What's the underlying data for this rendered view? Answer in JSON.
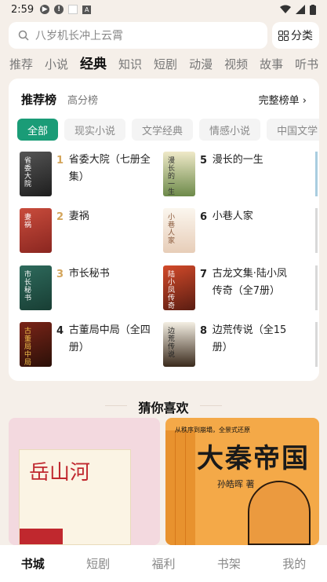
{
  "status_bar": {
    "time": "2:59",
    "icon_a": "A"
  },
  "search": {
    "placeholder": "八岁机长冲上云霄",
    "category_label": "分类"
  },
  "top_tabs": [
    "推荐",
    "小说",
    "经典",
    "知识",
    "短剧",
    "动漫",
    "视频",
    "故事",
    "听书"
  ],
  "active_tab": "经典",
  "rank": {
    "tab_active": "推荐榜",
    "tab_inactive": "高分榜",
    "full_link": "完整榜单 ›",
    "chips": [
      "全部",
      "现实小说",
      "文学经典",
      "情感小说",
      "中国文学"
    ],
    "books": [
      {
        "rank": "1",
        "title": "省委大院（七册全集）",
        "cover_text": "省委大院"
      },
      {
        "rank": "2",
        "title": "妻祸",
        "cover_text": "妻祸"
      },
      {
        "rank": "3",
        "title": "市长秘书",
        "cover_text": "市长秘书"
      },
      {
        "rank": "4",
        "title": "古董局中局（全四册）",
        "cover_text": "古董局中局"
      },
      {
        "rank": "5",
        "title": "漫长的一生",
        "cover_text": "漫长的一生"
      },
      {
        "rank": "6",
        "title": "小巷人家",
        "cover_text": "小巷人家"
      },
      {
        "rank": "7",
        "title": "古龙文集·陆小凤传奇（全7册）",
        "cover_text": "陆小凤传奇"
      },
      {
        "rank": "8",
        "title": "边荒传说（全15册）",
        "cover_text": "边荒传说"
      }
    ]
  },
  "guess": {
    "title": "猜你喜欢",
    "left_card_text": "岳山河",
    "right_card_banner": "从秩序到崩塌，全景式还原",
    "right_card_title": "大秦帝国",
    "right_card_author": "孙皓晖 著"
  },
  "bottom_nav": [
    "书城",
    "短剧",
    "福利",
    "书架",
    "我的"
  ],
  "colors": {
    "accent": "#1a9c77",
    "rank_gold": "#d4a55b"
  }
}
